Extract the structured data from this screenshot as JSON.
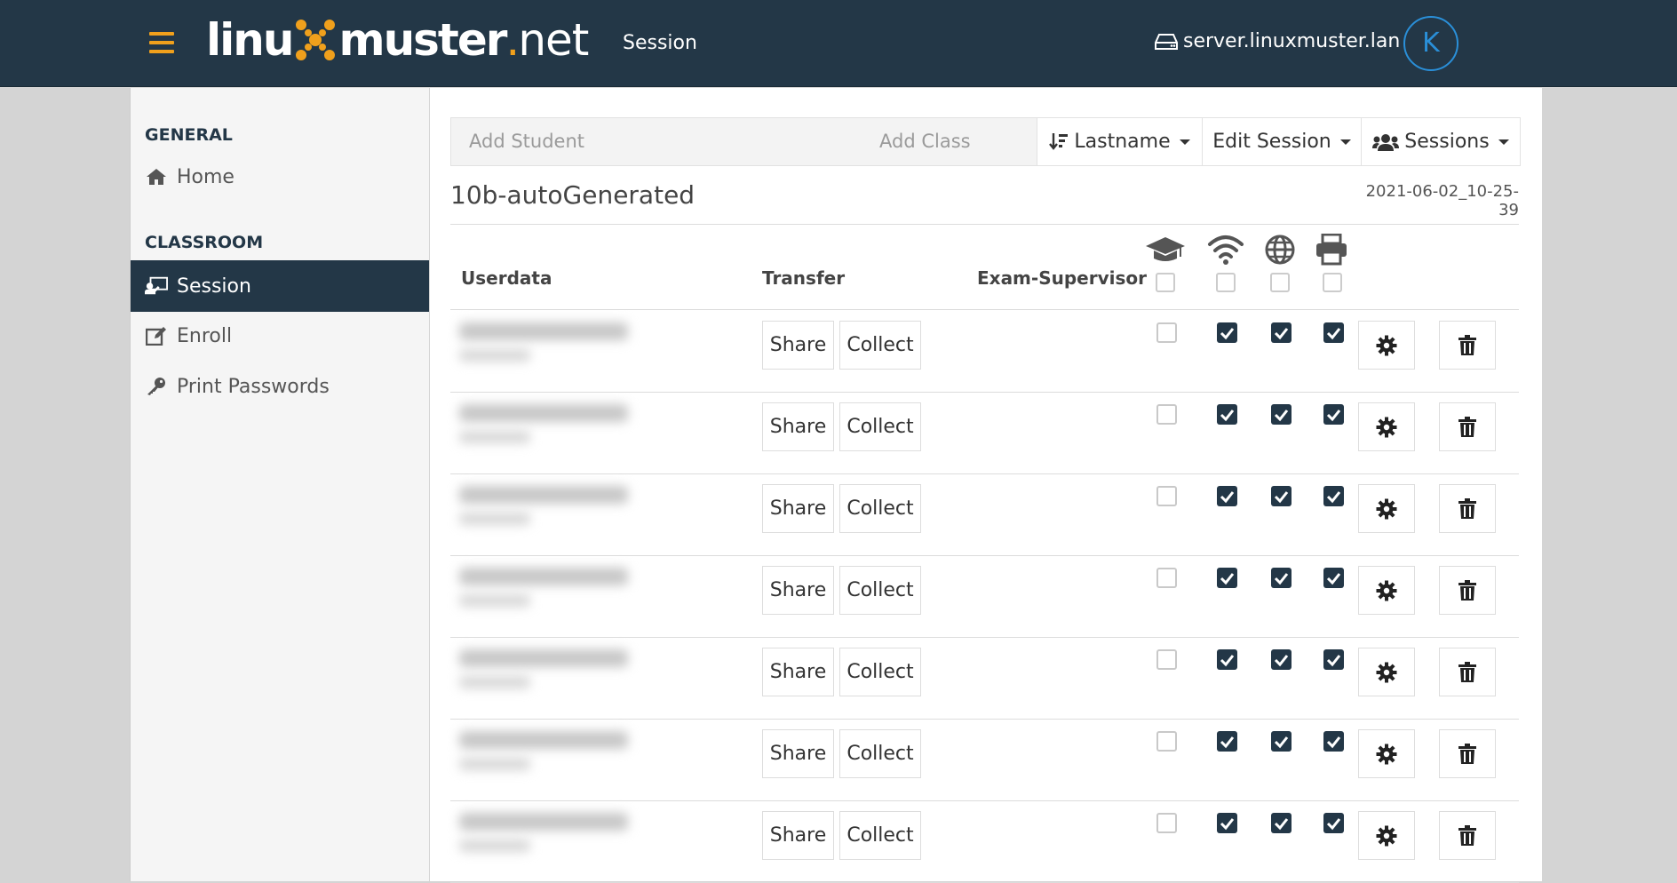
{
  "header": {
    "logo_text_1": "linu",
    "logo_text_2": "muster",
    "logo_text_3": "net",
    "page_title": "Session",
    "server": "server.linuxmuster.lan",
    "avatar_letter": "K",
    "accent_color": "#f0a01c",
    "bar_color": "#233747"
  },
  "sidebar": {
    "general_heading": "GENERAL",
    "home_label": "Home",
    "classroom_heading": "CLASSROOM",
    "session_label": "Session",
    "enroll_label": "Enroll",
    "print_label": "Print Passwords"
  },
  "toolbar": {
    "add_student_placeholder": "Add Student",
    "add_class_placeholder": "Add Class",
    "sort_label": "Lastname",
    "edit_label": "Edit Session",
    "sessions_label": "Sessions"
  },
  "session": {
    "name": "10b-autoGenerated",
    "date": "2021-06-02_10-25-39"
  },
  "table": {
    "col_userdata": "Userdata",
    "col_transfer": "Transfer",
    "col_exam": "Exam-Supervisor",
    "share_label": "Share",
    "collect_label": "Collect",
    "rows": [
      {
        "exam": false,
        "wifi": true,
        "internet": true,
        "printer": true
      },
      {
        "exam": false,
        "wifi": true,
        "internet": true,
        "printer": true
      },
      {
        "exam": false,
        "wifi": true,
        "internet": true,
        "printer": true
      },
      {
        "exam": false,
        "wifi": true,
        "internet": true,
        "printer": true
      },
      {
        "exam": false,
        "wifi": true,
        "internet": true,
        "printer": true
      },
      {
        "exam": false,
        "wifi": true,
        "internet": true,
        "printer": true
      },
      {
        "exam": false,
        "wifi": true,
        "internet": true,
        "printer": true
      }
    ],
    "icons": [
      "graduation-cap-icon",
      "wifi-icon",
      "globe-icon",
      "printer-icon",
      "gear-icon",
      "trash-icon"
    ]
  }
}
